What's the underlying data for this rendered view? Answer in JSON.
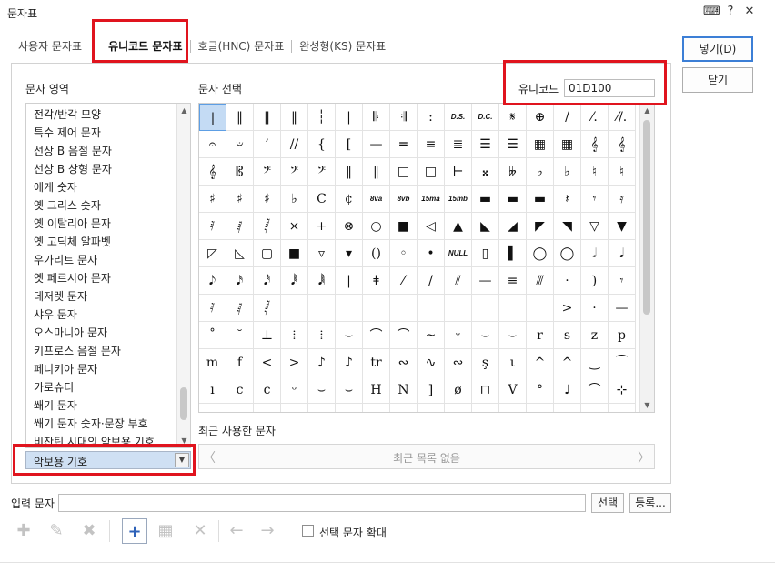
{
  "window": {
    "title": "문자표",
    "help_icon": "?",
    "close_icon": "✕",
    "keyboard_icon": "⌨"
  },
  "tabs": [
    {
      "label": "사용자 문자표",
      "active": false
    },
    {
      "label": "유니코드 문자표",
      "active": true
    },
    {
      "label": "호글(HNC) 문자표",
      "active": false
    },
    {
      "label": "완성형(KS) 문자표",
      "active": false
    }
  ],
  "area": {
    "label": "문자 영역",
    "items": [
      "전각/반각 모양",
      "특수 제어 문자",
      "선상 B 음절 문자",
      "선상 B 상형 문자",
      "에게 숫자",
      "옛 그리스 숫자",
      "옛 이탈리아 문자",
      "옛 고딕체 알파벳",
      "우가리트 문자",
      "옛 페르시아 문자",
      "데저렛 문자",
      "샤우 문자",
      "오스마니아 문자",
      "키프로스 음절 문자",
      "페니키아 문자",
      "카로슈티",
      "쐐기 문자",
      "쐐기 문자 숫자·문장 부호",
      "비잔틴 시대의 악보용 기호"
    ],
    "selected": "악보용 기호"
  },
  "char_select": {
    "label": "문자 선택"
  },
  "unicode": {
    "label": "유니코드",
    "value": "01D100"
  },
  "glyphs": [
    [
      "|",
      "‖",
      "‖",
      "‖",
      "┆",
      "|",
      "𝄆",
      "𝄇",
      ":",
      "D.S.",
      "D.C.",
      "𝄋",
      "⊕",
      "/",
      "⁄.",
      "⁄/."
    ],
    [
      "𝄐",
      "𝄑",
      "’",
      "//",
      "{",
      "[",
      "—",
      "═",
      "≡",
      "≣",
      "☰",
      "☰",
      "▦",
      "▦",
      "𝄞",
      "𝄞"
    ],
    [
      "𝄞",
      "𝄡",
      "𝄢",
      "𝄢",
      "𝄢",
      "‖",
      "‖",
      "□",
      "□",
      "⊢",
      "𝄪",
      "𝄫",
      "♭",
      "♭",
      "♮",
      "♮"
    ],
    [
      "♯",
      "♯",
      "♯",
      "♭",
      "C",
      "¢",
      "8va",
      "8vb",
      "15ma",
      "15mb",
      "▬",
      "▬",
      "▬",
      "𝄽",
      "𝄾",
      "𝄿"
    ],
    [
      "𝅀",
      "𝅁",
      "𝅂",
      "×",
      "+",
      "⊗",
      "○",
      "■",
      "◁",
      "▲",
      "◣",
      "◢",
      "◤",
      "◥",
      "▽",
      "▼"
    ],
    [
      "◸",
      "◺",
      "▢",
      "■",
      "▿",
      "▾",
      "()",
      "◦",
      "•",
      "NULL",
      "▯",
      "▌",
      "◯",
      "◯",
      "𝅗𝅥",
      "𝅘𝅥"
    ],
    [
      "𝅘𝅥𝅮",
      "𝅘𝅥𝅯",
      "𝅘𝅥𝅰",
      "𝅘𝅥𝅱",
      "𝅘𝅥𝅲",
      "|",
      "ǂ",
      "⁄",
      "/",
      "⫽",
      "—",
      "≡",
      "⫻",
      "·",
      ")",
      "𝄾"
    ],
    [
      "𝅀",
      "𝅁",
      "𝅂",
      "",
      "",
      "",
      "",
      "",
      "",
      "",
      "",
      "",
      "",
      ">",
      "·",
      "—"
    ],
    [
      "˚",
      "˘",
      "⊥",
      "⁞",
      "⁞",
      "⌣",
      "⌒",
      "⌒",
      "~",
      "ᵕ",
      "⌣",
      "⌣",
      "r",
      "s",
      "z",
      "p"
    ],
    [
      "m",
      "f",
      "<",
      ">",
      "♪",
      "♪",
      "tr",
      "∾",
      "∿",
      "∾",
      "ş",
      "ι",
      "^",
      "^",
      "‿",
      "⁀"
    ],
    [
      "ı",
      "c",
      "c",
      "ᵕ",
      "⌣",
      "⌣",
      "H",
      "N",
      "]",
      "ø",
      "⊓",
      "V",
      "°",
      "♩",
      "⌒",
      "⊹"
    ],
    [
      "",
      "",
      "",
      "",
      "",
      "",
      "",
      "",
      "",
      "",
      "",
      "",
      "",
      "",
      "",
      ""
    ]
  ],
  "recent": {
    "label": "최근 사용한 문자",
    "empty_text": "최근 목록 없음",
    "prev": "〈",
    "next": "〉"
  },
  "buttons": {
    "insert": "넣기(D)",
    "close": "닫기",
    "select": "선택",
    "register": "등록..."
  },
  "input_label": "입력 문자",
  "toolbar": {
    "add": "+",
    "delete": "✕",
    "left": "←",
    "right": "→",
    "enlarge_label": "선택 문자 확대"
  }
}
